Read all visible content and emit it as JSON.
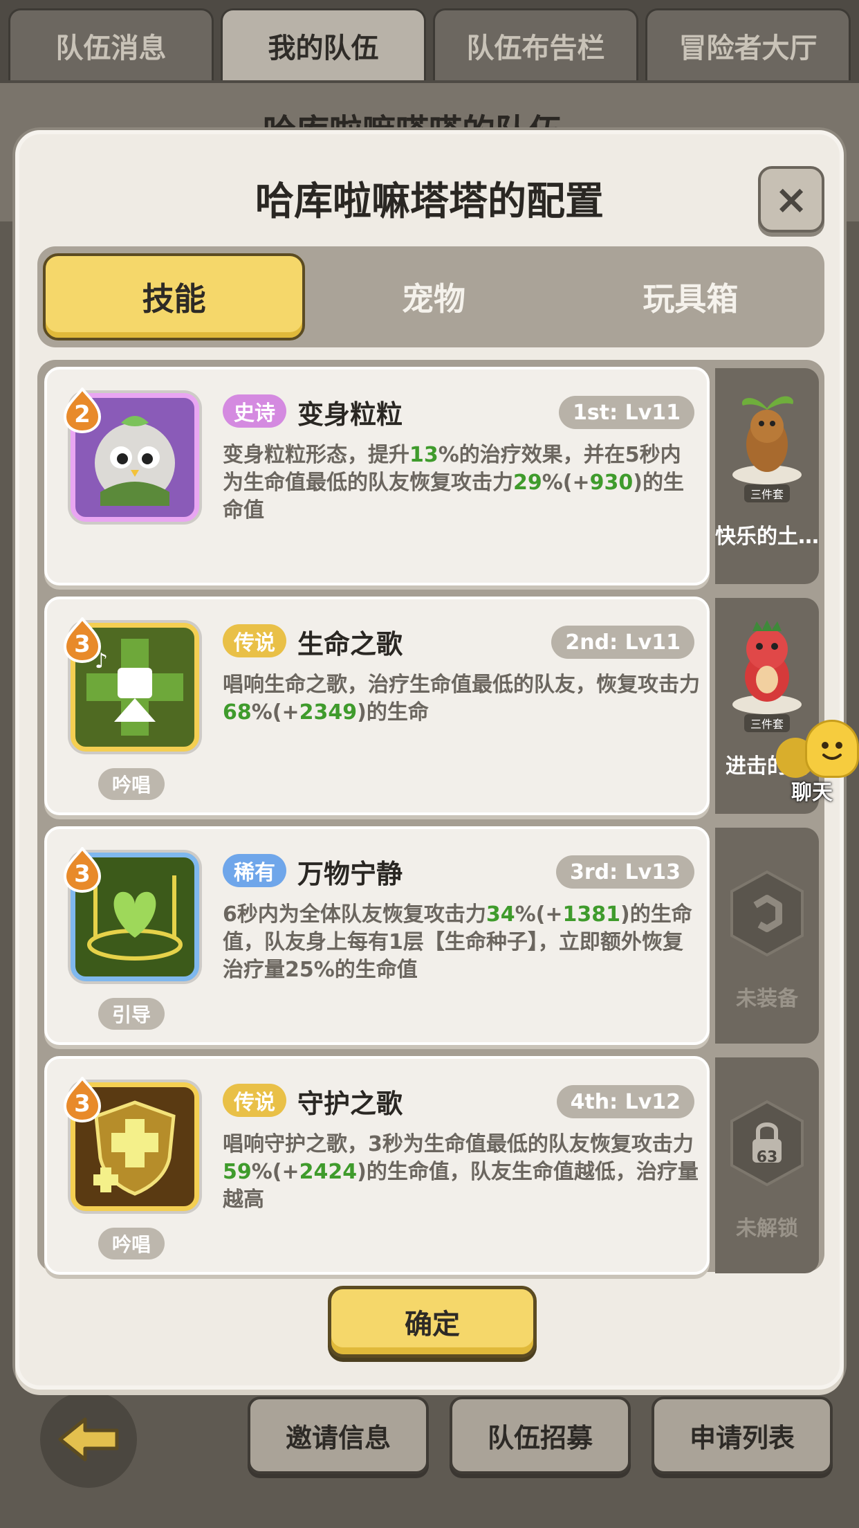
{
  "top_tabs": [
    {
      "label": "队伍消息"
    },
    {
      "label": "我的队伍"
    },
    {
      "label": "队伍布告栏"
    },
    {
      "label": "冒险者大厅"
    }
  ],
  "background": {
    "team_title": "哈库啦嘛嗒嗒的队伍"
  },
  "modal": {
    "title": "哈库啦嘛塔塔的配置",
    "close_label": "×",
    "tabs": [
      {
        "label": "技能"
      },
      {
        "label": "宠物"
      },
      {
        "label": "玩具箱"
      }
    ],
    "skills": [
      {
        "rank": "2",
        "icon": "owl-transform-icon",
        "type": "",
        "rarity": "史诗",
        "rarity_color": "#d48ae0",
        "name": "变身粒粒",
        "slot": "1st: Lv11",
        "desc_parts": [
          "变身粒粒形态，提升",
          "13",
          "%的治疗效果，并在5秒内为生命值最低的队友恢复攻击力",
          "29",
          "%(+",
          "930",
          ")的生命值"
        ]
      },
      {
        "rank": "3",
        "icon": "song-of-life-icon",
        "type": "吟唱",
        "rarity": "传说",
        "rarity_color": "#e9c047",
        "name": "生命之歌",
        "slot": "2nd: Lv11",
        "desc_parts": [
          "唱响生命之歌，治疗生命值最低的队友，恢复攻击力",
          "68",
          "%(+",
          "2349",
          ")的生命"
        ]
      },
      {
        "rank": "3",
        "icon": "serenity-icon",
        "type": "引导",
        "rarity": "稀有",
        "rarity_color": "#6fa6ea",
        "name": "万物宁静",
        "slot": "3rd: Lv13",
        "desc_parts": [
          "6秒内为全体队友恢复攻击力",
          "34",
          "%(+",
          "1381",
          ")的生命值，队友身上每有1层【生命种子】，立即额外恢复治疗量25%的生命值"
        ]
      },
      {
        "rank": "3",
        "icon": "guardian-song-icon",
        "type": "吟唱",
        "rarity": "传说",
        "rarity_color": "#e9c047",
        "name": "守护之歌",
        "slot": "4th: Lv12",
        "desc_parts": [
          "唱响守护之歌，3秒为生命值最低的队友恢复攻击力",
          "59",
          "%(+",
          "2424",
          ")的生命值，队友生命值越低，治疗量越高"
        ]
      }
    ],
    "side_items": [
      {
        "label": "快乐的土…",
        "tag": "三件套",
        "icon": "mole-toy-icon"
      },
      {
        "label": "进击的霸",
        "tag": "三件套",
        "icon": "red-dino-toy-icon"
      },
      {
        "label": "未装备",
        "tag": "",
        "icon": "empty-slot-icon"
      },
      {
        "label": "未解锁",
        "tag": "",
        "icon": "locked-slot-icon",
        "lock_level": "63"
      }
    ],
    "confirm_label": "确定"
  },
  "chat": {
    "label": "聊天"
  },
  "bottom_buttons": [
    {
      "label": "邀请信息"
    },
    {
      "label": "队伍招募"
    },
    {
      "label": "申请列表"
    }
  ]
}
